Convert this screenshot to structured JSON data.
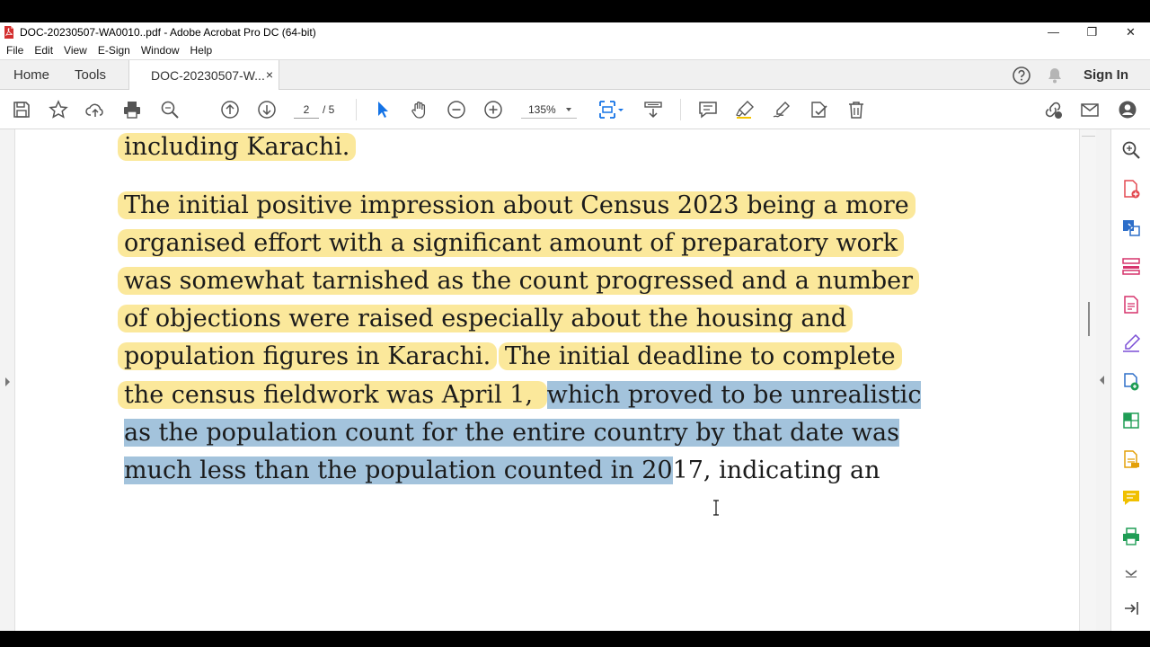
{
  "window": {
    "title": "DOC-20230507-WA0010..pdf - Adobe Acrobat Pro DC (64-bit)",
    "minimize": "—",
    "restore": "❐",
    "close": "✕"
  },
  "menu": [
    "File",
    "Edit",
    "View",
    "E-Sign",
    "Window",
    "Help"
  ],
  "tabs": {
    "home": "Home",
    "tools": "Tools",
    "doc": "DOC-20230507-W...",
    "close": "×",
    "sign_in": "Sign In"
  },
  "toolbar": {
    "page_current": "2",
    "page_total": "/ 5",
    "zoom": "135%"
  },
  "document": {
    "lines": [
      {
        "parts": [
          {
            "t": "including Karachi.",
            "style": "hl"
          }
        ]
      },
      {
        "parts": [
          {
            "t": "The initial positive impression about Census 2023 being a more",
            "style": "hl"
          }
        ]
      },
      {
        "parts": [
          {
            "t": "organised effort with a significant amount of preparatory work",
            "style": "hl"
          }
        ]
      },
      {
        "parts": [
          {
            "t": "was somewhat tarnished as the count progressed and a number",
            "style": "hl"
          }
        ]
      },
      {
        "parts": [
          {
            "t": "of objections were raised especially about the housing and",
            "style": "hl"
          }
        ]
      },
      {
        "parts": [
          {
            "t": "population figures in Karachi.",
            "style": "hl"
          },
          {
            "t": " ",
            "style": "plain"
          },
          {
            "t": "The initial deadline to complete",
            "style": "hl"
          }
        ]
      },
      {
        "parts": [
          {
            "t": "the census fieldwork was April 1, ",
            "style": "hl"
          },
          {
            "t": "which proved to be unrealistic",
            "style": "sel"
          }
        ]
      },
      {
        "parts": [
          {
            "t": "as the population count for the entire country by that date was",
            "style": "sel"
          }
        ]
      },
      {
        "parts": [
          {
            "t": "much less than the population counted in 20",
            "style": "sel"
          },
          {
            "t": "17, indicating an",
            "style": "plain"
          }
        ]
      }
    ]
  },
  "colors": {
    "highlight": "#fbe89b",
    "selection": "#a3c3dc",
    "accent_blue": "#1473e6"
  },
  "icons": {
    "toolbar": [
      "save-icon",
      "star-icon",
      "cloud-upload-icon",
      "print-icon",
      "search-icon",
      "page-up-icon",
      "page-down-icon",
      "select-cursor-icon",
      "hand-icon",
      "zoom-out-icon",
      "zoom-in-icon",
      "fit-page-icon",
      "scroll-mode-icon",
      "comment-icon",
      "highlighter-icon",
      "sign-icon",
      "stamp-icon",
      "delete-icon",
      "share-link-icon",
      "email-icon",
      "account-icon"
    ],
    "right_panel": [
      "zoom-search-icon",
      "create-pdf-icon",
      "export-pdf-icon",
      "organize-pages-icon",
      "edit-pdf-icon",
      "fill-sign-icon",
      "combine-files-icon",
      "excel-export-icon",
      "scan-icon",
      "comment-panel-icon",
      "print-production-icon",
      "expand-more-icon",
      "collapse-panel-icon"
    ]
  }
}
